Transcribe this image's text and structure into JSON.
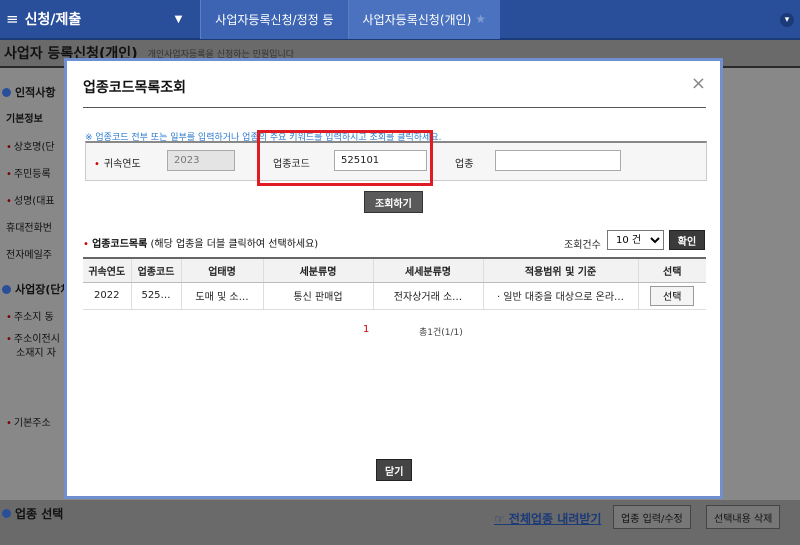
{
  "header": {
    "menu_label": "신청/제출",
    "breadcrumb_1": "사업자등록신청/정정 등",
    "breadcrumb_2": "사업자등록신청(개인)"
  },
  "page": {
    "title": "사업자 등록신청(개인)",
    "description": "개인사업자등록을 신청하는 민원입니다"
  },
  "background_form": {
    "section_personal": "인적사항",
    "basic_info": "기본정보",
    "trade_name": "상호명(단",
    "resident_no": "주민등록",
    "name": "성명(대표",
    "mobile": "휴대전화번",
    "email": "전자메일주",
    "section_business": "사업장(단체",
    "address": "주소지 동",
    "address_move_1": "주소이전시",
    "address_move_2": "소재지 자",
    "base_address": "기본주소"
  },
  "bottom_bar": {
    "section": "업종 선택",
    "expand_link": "☞ 전체업종 내려받기",
    "input_button": "업종 입력/수정",
    "delete_button": "선택내용 삭제"
  },
  "modal": {
    "title": "업종코드목록조회",
    "close_symbol": "×",
    "notice": "※ 업종코드 전부 또는 일부를 입력하거나 업종의 주요 키워드를 입력하시고 조회를 클릭하세요.",
    "fields": {
      "year_label": "귀속연도",
      "year_value": "2023",
      "code_label": "업종코드",
      "code_value": "525101",
      "industry_label": "업종",
      "industry_value": ""
    },
    "search_button": "조회하기",
    "list": {
      "title": "업종코드목록",
      "hint": "(해당 업종을 더블 클릭하여 선택하세요)",
      "count_label": "조회건수",
      "count_value": "10 건",
      "count_options": [
        "10 건"
      ],
      "ok_button": "확인",
      "columns": [
        "귀속연도",
        "업종코드",
        "업태명",
        "세분류명",
        "세세분류명",
        "적용범위 및 기준",
        "선택"
      ],
      "rows": [
        {
          "year": "2022",
          "code": "525…",
          "business_type": "도매 및 소…",
          "sub_class": "통신 판매업",
          "detail_class": "전자상거래 소…",
          "scope": "· 일반 대중을 대상으로 온라…",
          "select_label": "선택"
        }
      ]
    },
    "pager": {
      "current_page": "1",
      "total": "총1건(1/1)"
    },
    "close_button": "닫기"
  },
  "colors": {
    "header_blue": "#2a4f9a",
    "highlight_red": "#e01b24",
    "modal_border": "#6f8fd0"
  }
}
